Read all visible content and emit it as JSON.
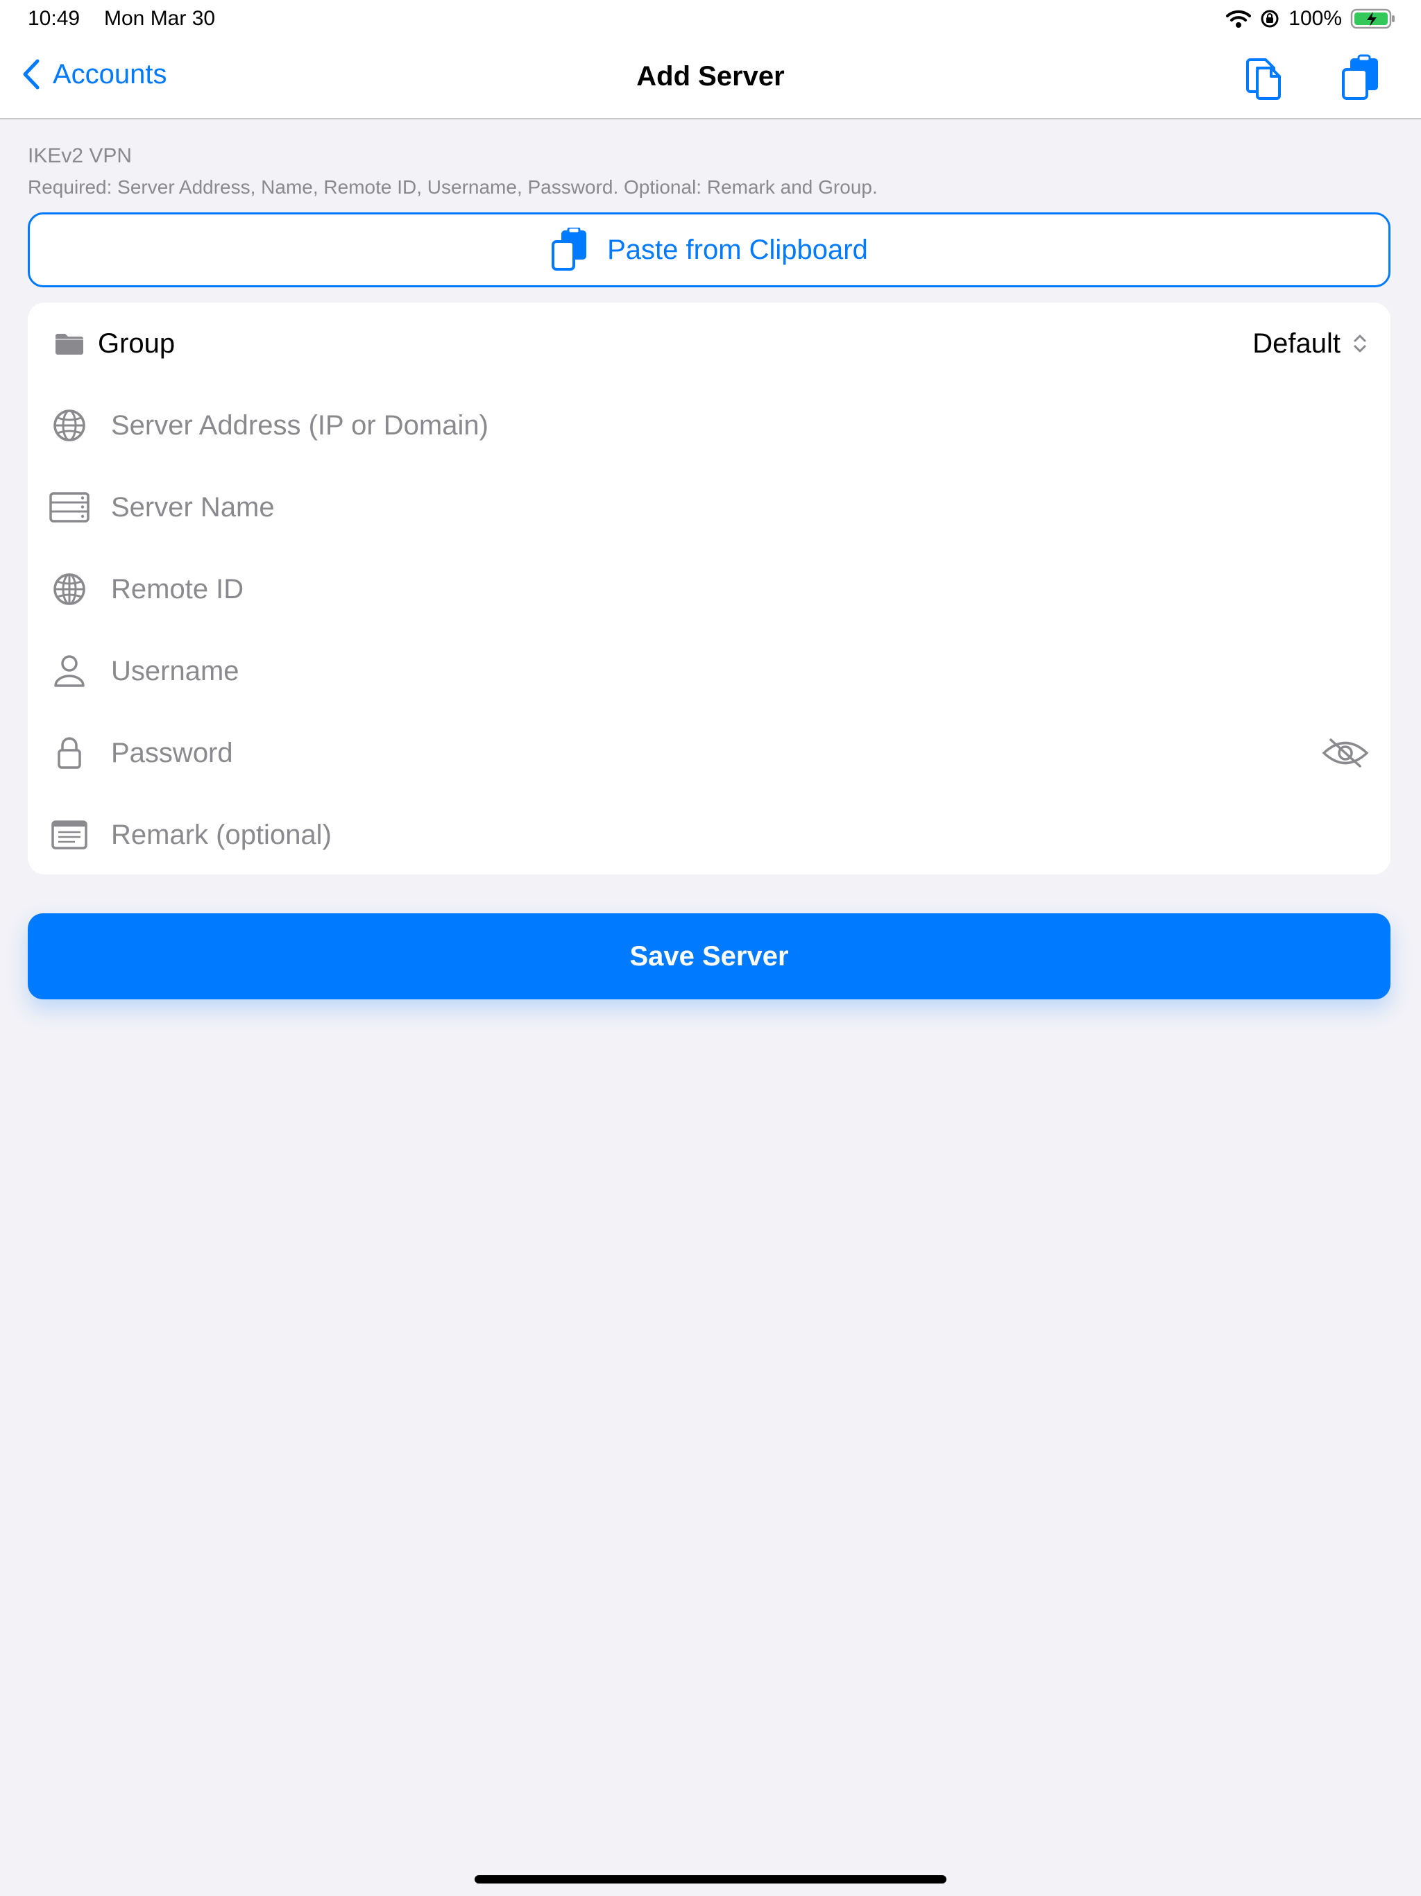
{
  "status_bar": {
    "time": "10:49",
    "date": "Mon Mar 30",
    "battery_percent": "100%",
    "battery_color": "#34c759"
  },
  "nav": {
    "back_label": "Accounts",
    "title": "Add Server",
    "accent": "#007aff"
  },
  "section": {
    "title": "IKEv2 VPN",
    "subtitle": "Required: Server Address, Name, Remote ID, Username, Password. Optional: Remark and Group."
  },
  "paste_button": {
    "label": "Paste from Clipboard"
  },
  "form": {
    "group": {
      "label": "Group",
      "value": "Default"
    },
    "server_address": {
      "placeholder": "Server Address (IP or Domain)",
      "value": ""
    },
    "server_name": {
      "placeholder": "Server Name",
      "value": ""
    },
    "remote_id": {
      "placeholder": "Remote ID",
      "value": ""
    },
    "username": {
      "placeholder": "Username",
      "value": ""
    },
    "password": {
      "placeholder": "Password",
      "value": ""
    },
    "remark": {
      "placeholder": "Remark (optional)",
      "value": ""
    }
  },
  "save_button": {
    "label": "Save Server"
  }
}
